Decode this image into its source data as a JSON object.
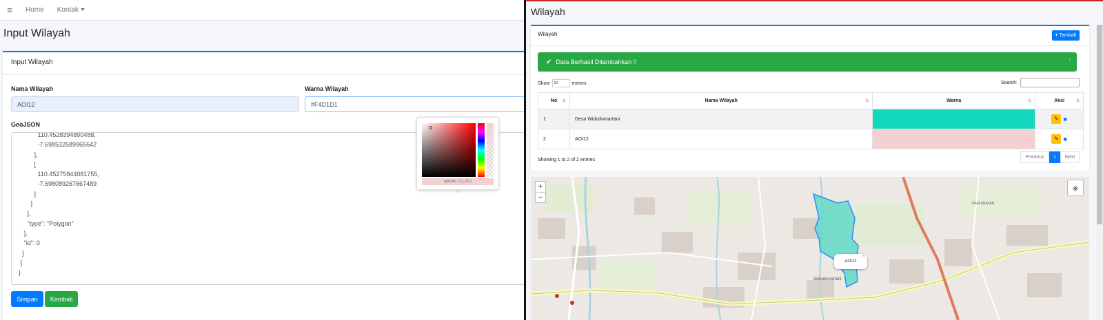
{
  "left": {
    "nav": {
      "home": "Home",
      "kontak": "Kontak"
    },
    "page_title": "Input Wilayah",
    "card_title": "Input Wilayah",
    "form": {
      "nama_label": "Nama Wilayah",
      "nama_value": "AOI12",
      "warna_label": "Warna Wilayah",
      "warna_value": "#F4D1D1",
      "geojson_label": "GeoJSON",
      "geojson_text": "           110.4528394800488,\n           -7.698532589965642\n         ],\n         [\n           110.45275844081755,\n           -7.698089267667489\n         ]\n       ]\n     ],\n     \"type\": \"Polygon\"\n   },\n   \"id\": 0\n  }\n ]\n}",
      "simpan": "Simpan",
      "kembali": "Kembali"
    },
    "picker": {
      "value_text": "rgb(245, 211, 211)",
      "color": "#F4D1D1"
    }
  },
  "right": {
    "page_title": "Wilayah",
    "card_title": "Wilayah",
    "tambah": "Tambah",
    "alert": "Data Berhasil Ditambahkan !!",
    "show_label": "Show",
    "show_value": "10",
    "entries_label": "entries",
    "search_label": "Search:",
    "table": {
      "headers": [
        "No",
        "Nama Wilayah",
        "Warna",
        "Aksi"
      ],
      "rows": [
        {
          "no": "1",
          "nama": "Desa Widodomartani",
          "warna": "#11d8bd"
        },
        {
          "no": "2",
          "nama": "AOI12",
          "warna": "#f4d1d1"
        }
      ]
    },
    "info": "Showing 1 to 2 of 2 entries",
    "pager": {
      "prev": "Previous",
      "page": "1",
      "next": "Next"
    },
    "map": {
      "zoom_in": "+",
      "zoom_out": "−",
      "popup": "AOI12",
      "popup_close": "×",
      "labels": [
        "Widodomartani",
        "DAM KRAJAN"
      ],
      "colors": {
        "polygon_fill": "#4fd9c3",
        "polygon_stroke": "#3388ff"
      }
    }
  },
  "colors": {
    "primary": "#007bff",
    "success": "#28a745",
    "warning": "#ffc107"
  }
}
